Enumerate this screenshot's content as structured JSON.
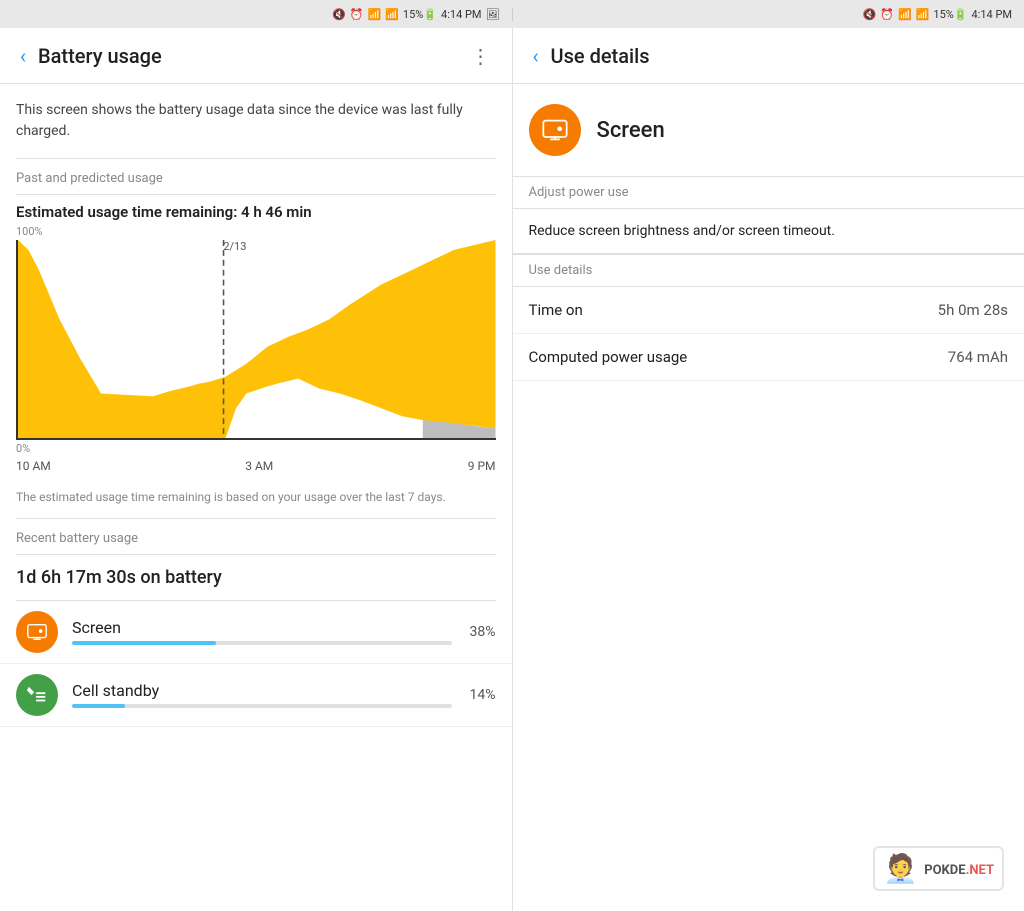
{
  "statusBar": {
    "left": {
      "icons": "🔇⏰📶📶",
      "battery": "15%🔋",
      "time": "4:14 PM",
      "image": "🖼"
    },
    "right": {
      "icons": "🔇⏰📶📶",
      "battery": "15%🔋",
      "time": "4:14 PM"
    }
  },
  "leftPanel": {
    "appBar": {
      "back": "‹",
      "title": "Battery usage",
      "more": "⋮"
    },
    "infoText": "This screen shows the battery usage data since the device was last fully charged.",
    "sectionHeaders": {
      "pastAndPredicted": "Past and predicted usage",
      "recentBatteryUsage": "Recent battery usage"
    },
    "estimatedTime": "Estimated usage time remaining: 4 h 46 min",
    "chartLabels": {
      "top100": "100%",
      "top0": "0%",
      "dateLabel": "2/13",
      "bottomLeft": "10 AM",
      "bottomMiddle": "3 AM",
      "bottomRight": "9 PM"
    },
    "chartNote": "The estimated usage time remaining is based on your usage over the last 7 days.",
    "batteryDuration": "1d 6h 17m 30s on battery",
    "usageItems": [
      {
        "name": "Screen",
        "percent": "38%",
        "barWidth": 38,
        "iconColor": "orange",
        "iconSymbol": "📱"
      },
      {
        "name": "Cell standby",
        "percent": "14%",
        "barWidth": 14,
        "iconColor": "green",
        "iconSymbol": "📶"
      }
    ]
  },
  "rightPanel": {
    "appBar": {
      "back": "‹",
      "title": "Use details"
    },
    "detailHeader": {
      "iconSymbol": "📱",
      "title": "Screen"
    },
    "adjustPowerUse": {
      "sectionLabel": "Adjust power use",
      "text": "Reduce screen brightness and/or screen timeout."
    },
    "useDetails": {
      "sectionLabel": "Use details",
      "rows": [
        {
          "label": "Time on",
          "value": "5h 0m 28s"
        },
        {
          "label": "Computed power usage",
          "value": "764 mAh"
        }
      ]
    }
  },
  "watermark": {
    "text": "POKDE",
    "suffix": ".NET"
  }
}
